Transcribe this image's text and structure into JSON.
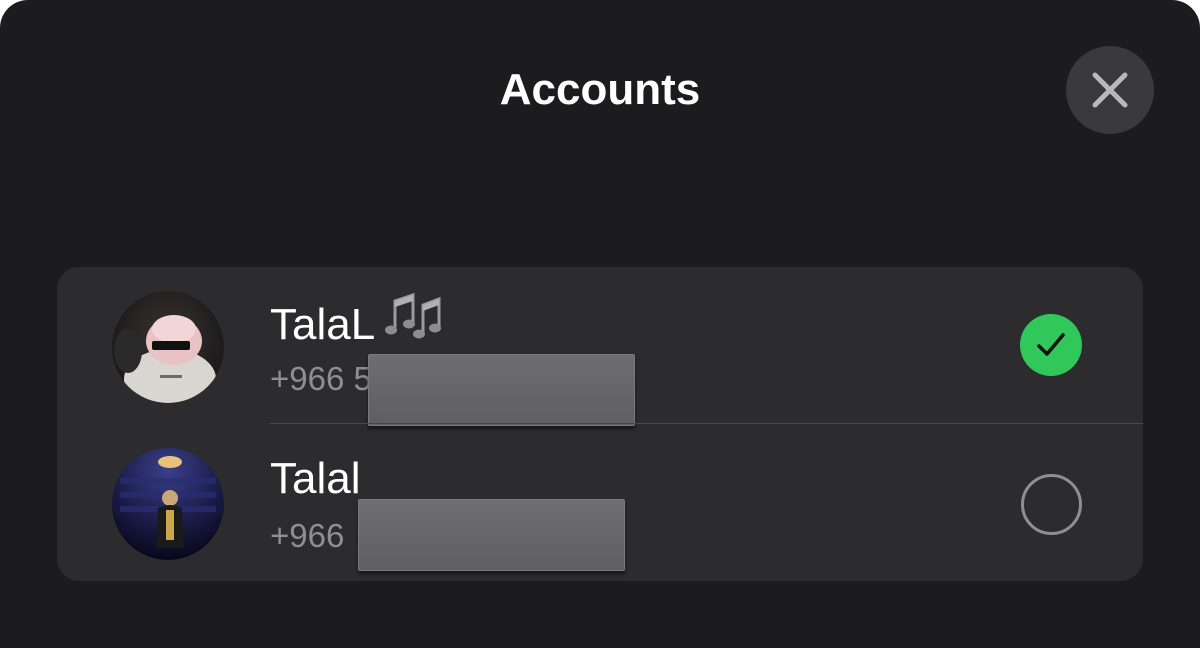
{
  "header": {
    "title": "Accounts",
    "close_icon": "close-icon"
  },
  "accounts": [
    {
      "name": "TalaL",
      "name_emoji": "multiple-musical-notes-icon",
      "phone_prefix": "+966",
      "phone_visible_fragment": "5",
      "selected": true,
      "status_icon": "checkmark-circle-icon",
      "status_color": "#30c85a"
    },
    {
      "name": "Talal",
      "phone_prefix": "+966",
      "selected": false,
      "status_icon": "empty-circle-icon"
    }
  ],
  "colors": {
    "background": "#1c1c1e",
    "card": "#2c2c2e",
    "accent_green": "#30c85a",
    "secondary_text": "#8e8e93"
  }
}
